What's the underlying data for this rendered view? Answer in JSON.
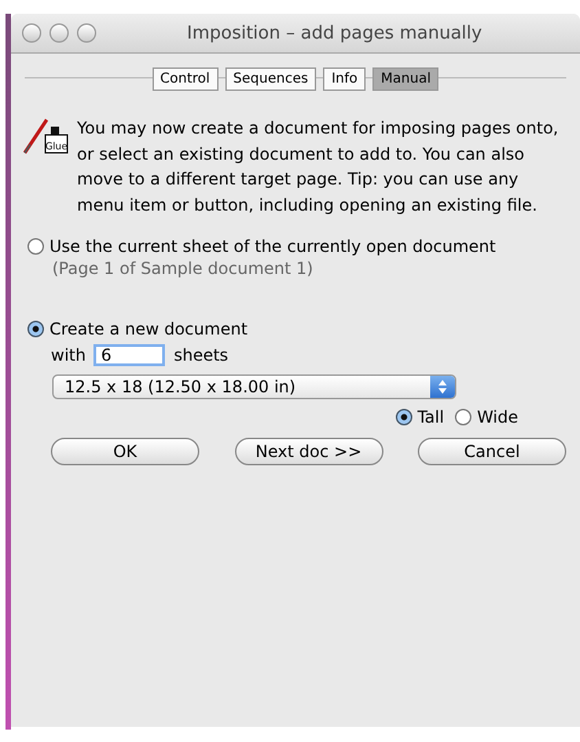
{
  "window": {
    "title": "Imposition – add pages manually"
  },
  "tabs": [
    {
      "label": "Control",
      "selected": false
    },
    {
      "label": "Sequences",
      "selected": false
    },
    {
      "label": "Info",
      "selected": false
    },
    {
      "label": "Manual",
      "selected": true
    }
  ],
  "icon_label": "Glue",
  "message": "You may now create a document for imposing pages onto, or select an existing document to add to. You can also move to a different target page. Tip: you can use any menu item or button, including opening an existing file.",
  "options": [
    {
      "label": "Use the current sheet of the currently open document",
      "note": "(Page 1 of Sample document 1)",
      "selected": false
    },
    {
      "label": "Create a new document",
      "selected": true
    }
  ],
  "sheets": {
    "prefix": "with",
    "value": "6",
    "suffix": "sheets"
  },
  "size_dropdown": {
    "value": "12.5 x 18 (12.50 x 18.00 in)"
  },
  "orientation": [
    {
      "label": "Tall",
      "selected": true
    },
    {
      "label": "Wide",
      "selected": false
    }
  ],
  "buttons": [
    "OK",
    "Next doc >>",
    "Cancel"
  ]
}
